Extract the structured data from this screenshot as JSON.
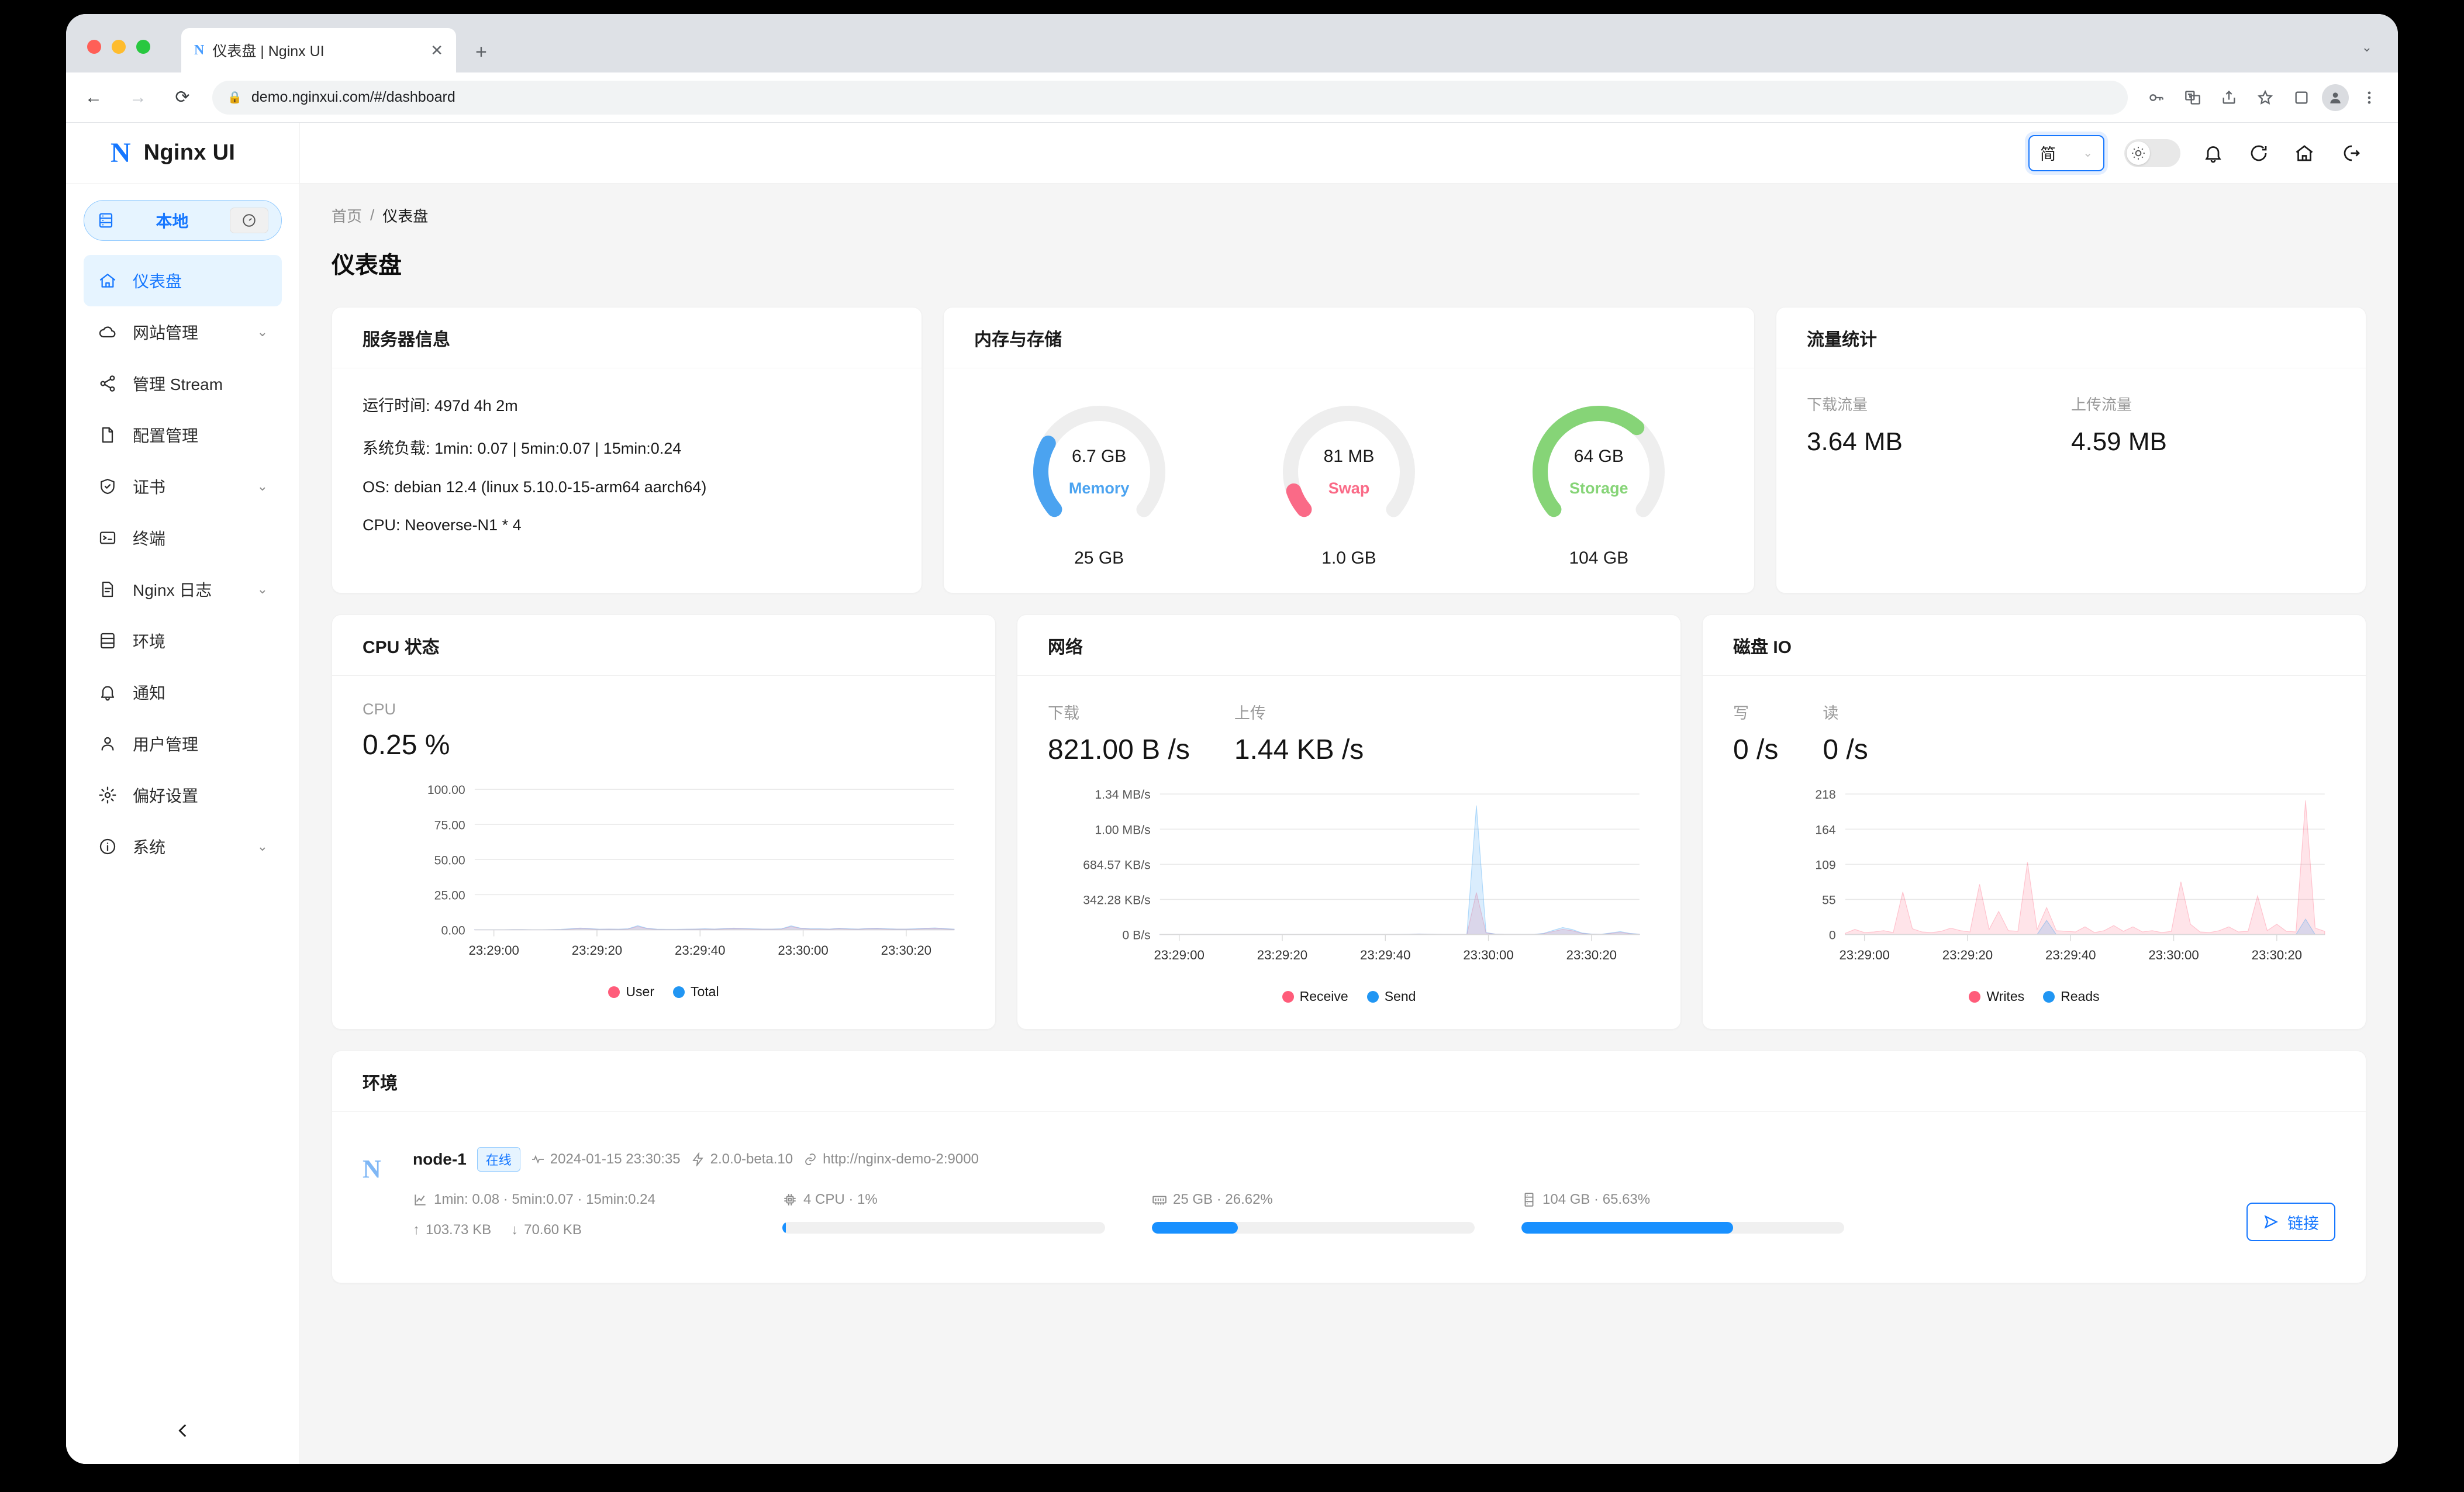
{
  "browser": {
    "tab_title": "仪表盘 | Nginx UI",
    "favicon_letter": "N",
    "close_label": "✕",
    "new_tab_label": "+",
    "url": "demo.nginxui.com/#/dashboard",
    "back_label": "←",
    "forward_label": "→",
    "reload_label": "⟳"
  },
  "sidebar": {
    "logo_mark": "N",
    "logo_text": "Nginx UI",
    "env_switch": {
      "label": "本地"
    },
    "items": [
      {
        "label": "仪表盘",
        "icon": "home-icon",
        "active": true,
        "chevron": false
      },
      {
        "label": "网站管理",
        "icon": "cloud-icon",
        "active": false,
        "chevron": true
      },
      {
        "label": "管理 Stream",
        "icon": "share-icon",
        "active": false,
        "chevron": false
      },
      {
        "label": "配置管理",
        "icon": "file-icon",
        "active": false,
        "chevron": false
      },
      {
        "label": "证书",
        "icon": "shield-icon",
        "active": false,
        "chevron": true
      },
      {
        "label": "终端",
        "icon": "terminal-icon",
        "active": false,
        "chevron": false
      },
      {
        "label": "Nginx 日志",
        "icon": "log-icon",
        "active": false,
        "chevron": true
      },
      {
        "label": "环境",
        "icon": "server-icon",
        "active": false,
        "chevron": false
      },
      {
        "label": "通知",
        "icon": "bell-icon",
        "active": false,
        "chevron": false
      },
      {
        "label": "用户管理",
        "icon": "user-icon",
        "active": false,
        "chevron": false
      },
      {
        "label": "偏好设置",
        "icon": "gear-icon",
        "active": false,
        "chevron": false
      },
      {
        "label": "系统",
        "icon": "info-icon",
        "active": false,
        "chevron": true
      }
    ]
  },
  "header": {
    "language": {
      "value": "简",
      "caret": "⌄"
    },
    "icons": [
      "sun-icon",
      "bell-icon",
      "refresh-icon",
      "home-icon",
      "logout-icon"
    ]
  },
  "breadcrumb": {
    "home": "首页",
    "sep": "/",
    "current": "仪表盘"
  },
  "page_title": "仪表盘",
  "server_info": {
    "title": "服务器信息",
    "lines": [
      "运行时间: 497d 4h 2m",
      "系统负载: 1min: 0.07 | 5min:0.07 | 15min:0.24",
      "OS: debian 12.4 (linux 5.10.0-15-arm64 aarch64)",
      "CPU: Neoverse-N1 * 4"
    ]
  },
  "memory_storage": {
    "title": "内存与存储",
    "gauges": [
      {
        "name": "Memory",
        "value": "6.7 GB",
        "total": "25 GB",
        "percent": 26.62,
        "color": "#4ba3f0"
      },
      {
        "name": "Swap",
        "value": "81 MB",
        "total": "1.0 GB",
        "percent": 8.0,
        "color": "#fa6a87"
      },
      {
        "name": "Storage",
        "value": "64 GB",
        "total": "104 GB",
        "percent": 65.63,
        "color": "#86d477"
      }
    ]
  },
  "traffic": {
    "title": "流量统计",
    "items": [
      {
        "label": "下载流量",
        "value": "3.64 MB"
      },
      {
        "label": "上传流量",
        "value": "4.59 MB"
      }
    ]
  },
  "cpu_card": {
    "title": "CPU 状态",
    "metrics": [
      {
        "label": "CPU",
        "value": "0.25 %"
      }
    ]
  },
  "network_card": {
    "title": "网络",
    "metrics": [
      {
        "label": "下载",
        "value": "821.00 B /s"
      },
      {
        "label": "上传",
        "value": "1.44 KB /s"
      }
    ]
  },
  "disk_card": {
    "title": "磁盘 IO",
    "metrics": [
      {
        "label": "写",
        "value": "0 /s"
      },
      {
        "label": "读",
        "value": "0 /s"
      }
    ]
  },
  "environment": {
    "title": "环境",
    "node": {
      "logo_mark": "N",
      "name": "node-1",
      "status": "在线",
      "timestamp": "2024-01-15 23:30:35",
      "version": "2.0.0-beta.10",
      "url": "http://nginx-demo-2:9000",
      "load": "1min: 0.08 · 5min:0.07 · 15min:0.24",
      "net_up": "103.73 KB",
      "net_down": "70.60 KB",
      "net_up_arrow": "↑",
      "net_down_arrow": "↓",
      "cpu": "4 CPU · 1%",
      "cpu_percent": 1,
      "memory": "25 GB · 26.62%",
      "memory_percent": 26.62,
      "storage": "104 GB · 65.63%",
      "storage_percent": 65.63,
      "link_button": "链接"
    }
  },
  "chart_data": [
    {
      "type": "area",
      "title": "CPU 状态",
      "xlabel": "",
      "ylabel": "",
      "x_ticks": [
        "23:29:00",
        "23:29:20",
        "23:29:40",
        "23:30:00",
        "23:30:20"
      ],
      "y_ticks": [
        "0.00",
        "25.00",
        "50.00",
        "75.00",
        "100.00"
      ],
      "ylim": [
        0,
        100
      ],
      "grid": true,
      "legend": [
        {
          "name": "User",
          "color": "#ff5c7a"
        },
        {
          "name": "Total",
          "color": "#2196f3"
        }
      ],
      "series": [
        {
          "name": "User",
          "values": [
            0.1,
            0.1,
            0.1,
            0.1,
            0.2,
            0.2,
            0.1,
            0.1,
            0.2,
            0.3,
            0.6,
            1.0,
            0.7,
            0.4,
            0.5,
            0.4,
            0.6,
            2.4,
            0.9,
            0.4,
            0.3,
            0.3,
            0.4,
            0.5,
            0.6,
            0.5,
            0.7,
            0.9,
            0.8,
            0.6,
            0.5,
            0.5,
            0.6,
            2.3,
            1.0,
            0.6,
            0.6,
            0.5,
            0.9,
            0.6,
            0.5,
            0.8,
            0.9,
            0.6,
            0.5,
            0.5,
            0.6,
            0.9,
            1.1,
            0.7,
            0.4
          ]
        },
        {
          "name": "Total",
          "values": [
            0.15,
            0.15,
            0.15,
            0.15,
            0.25,
            0.25,
            0.15,
            0.15,
            0.25,
            0.4,
            0.8,
            1.3,
            0.9,
            0.5,
            0.6,
            0.5,
            0.8,
            3.0,
            1.1,
            0.5,
            0.4,
            0.4,
            0.5,
            0.6,
            0.8,
            0.6,
            0.9,
            1.2,
            1.0,
            0.8,
            0.6,
            0.6,
            0.8,
            2.9,
            1.2,
            0.8,
            0.8,
            0.6,
            1.1,
            0.8,
            0.6,
            1.0,
            1.1,
            0.8,
            0.6,
            0.6,
            0.8,
            1.1,
            1.4,
            0.9,
            0.5
          ]
        }
      ]
    },
    {
      "type": "area",
      "title": "网络",
      "xlabel": "",
      "ylabel": "",
      "x_ticks": [
        "23:29:00",
        "23:29:20",
        "23:29:40",
        "23:30:00",
        "23:30:20"
      ],
      "y_ticks": [
        "0 B/s",
        "342.28 KB/s",
        "684.57 KB/s",
        "1.00 MB/s",
        "1.34 MB/s"
      ],
      "ylim": [
        0,
        1405000
      ],
      "grid": true,
      "legend": [
        {
          "name": "Receive",
          "color": "#ff5c7a"
        },
        {
          "name": "Send",
          "color": "#2196f3"
        }
      ],
      "series": [
        {
          "name": "Receive",
          "values": [
            600,
            600,
            700,
            600,
            700,
            800,
            700,
            600,
            700,
            900,
            1200,
            900,
            800,
            700,
            800,
            900,
            1000,
            2000,
            1200,
            800,
            700,
            800,
            900,
            1000,
            900,
            1200,
            2500,
            5000,
            3000,
            1500,
            900,
            800,
            1200,
            420000,
            16000,
            4000,
            2000,
            1500,
            1200,
            2000,
            9000,
            30000,
            52000,
            38000,
            12000,
            4000,
            2500,
            12000,
            22000,
            9000,
            3000
          ]
        },
        {
          "name": "Send",
          "values": [
            800,
            800,
            900,
            800,
            900,
            1000,
            900,
            800,
            900,
            1100,
            1500,
            1200,
            1000,
            900,
            1000,
            1100,
            1300,
            2600,
            1500,
            1000,
            900,
            1000,
            1100,
            1300,
            1100,
            1500,
            3000,
            6000,
            3600,
            1800,
            1100,
            1000,
            1500,
            1290000,
            20000,
            5000,
            2500,
            1800,
            1500,
            2500,
            12000,
            42000,
            70000,
            50000,
            16000,
            5000,
            3000,
            16000,
            30000,
            12000,
            4000
          ]
        }
      ]
    },
    {
      "type": "area",
      "title": "磁盘 IO",
      "xlabel": "",
      "ylabel": "",
      "x_ticks": [
        "23:29:00",
        "23:29:20",
        "23:29:40",
        "23:30:00",
        "23:30:20"
      ],
      "y_ticks": [
        "0",
        "55",
        "109",
        "164",
        "218"
      ],
      "ylim": [
        0,
        218
      ],
      "grid": true,
      "legend": [
        {
          "name": "Writes",
          "color": "#ff5c7a"
        },
        {
          "name": "Reads",
          "color": "#2196f3"
        }
      ],
      "series": [
        {
          "name": "Writes",
          "values": [
            2,
            8,
            3,
            4,
            6,
            3,
            66,
            9,
            4,
            3,
            5,
            10,
            6,
            4,
            78,
            8,
            36,
            6,
            5,
            112,
            8,
            42,
            6,
            5,
            4,
            12,
            3,
            6,
            14,
            5,
            12,
            4,
            6,
            3,
            5,
            82,
            16,
            4,
            3,
            6,
            12,
            4,
            5,
            60,
            6,
            16,
            5,
            4,
            208,
            10,
            5
          ]
        },
        {
          "name": "Reads",
          "values": [
            0,
            0,
            0,
            0,
            0,
            0,
            0,
            0,
            0,
            0,
            0,
            0,
            0,
            0,
            0,
            0,
            0,
            0,
            0,
            0,
            0,
            22,
            0,
            0,
            0,
            0,
            0,
            0,
            0,
            0,
            0,
            0,
            0,
            0,
            0,
            0,
            0,
            0,
            0,
            0,
            0,
            0,
            0,
            0,
            0,
            0,
            0,
            0,
            24,
            0,
            0
          ]
        }
      ]
    }
  ]
}
